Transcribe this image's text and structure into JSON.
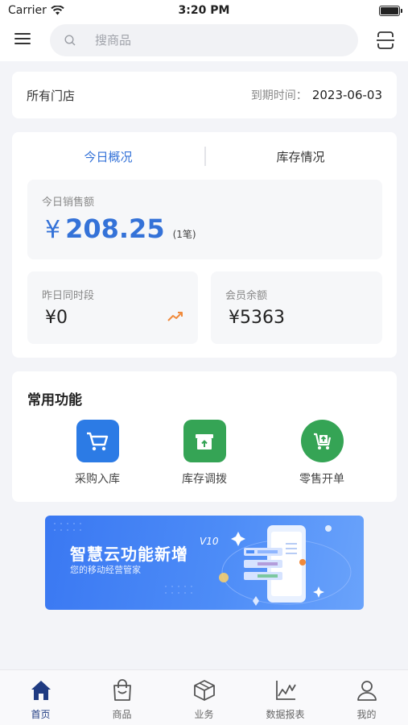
{
  "status_bar": {
    "carrier": "Carrier",
    "time": "3:20 PM"
  },
  "search": {
    "placeholder": "搜商品"
  },
  "store": {
    "name": "所有门店",
    "expire_label": "到期时间：",
    "expire_date": "2023-06-03"
  },
  "overview": {
    "tabs": [
      {
        "label": "今日概况",
        "active": true
      },
      {
        "label": "库存情况",
        "active": false
      }
    ],
    "sales": {
      "label": "今日销售额",
      "currency": "¥",
      "amount": "208.25",
      "count": "(1笔)"
    },
    "yesterday": {
      "label": "昨日同时段",
      "value": "¥0"
    },
    "member_balance": {
      "label": "会员余额",
      "value": "¥5363"
    }
  },
  "functions": {
    "title": "常用功能",
    "items": [
      {
        "label": "采购入库",
        "icon": "cart-icon",
        "color": "#2c7be5"
      },
      {
        "label": "库存调拨",
        "icon": "box-icon",
        "color": "#35a455"
      },
      {
        "label": "零售开单",
        "icon": "cart-upload-icon",
        "color": "#35a455"
      }
    ]
  },
  "banner": {
    "title": "智慧云功能新增",
    "version": "V10",
    "subtitle": "您的移动经营管家"
  },
  "tabbar": {
    "items": [
      {
        "label": "首页",
        "icon": "home-icon",
        "active": true
      },
      {
        "label": "商品",
        "icon": "bag-icon",
        "active": false
      },
      {
        "label": "业务",
        "icon": "cube-icon",
        "active": false
      },
      {
        "label": "数据报表",
        "icon": "chart-icon",
        "active": false
      },
      {
        "label": "我的",
        "icon": "user-icon",
        "active": false
      }
    ]
  },
  "colors": {
    "accent": "#3472d8",
    "green": "#35a455",
    "trend": "#f08a3c"
  }
}
